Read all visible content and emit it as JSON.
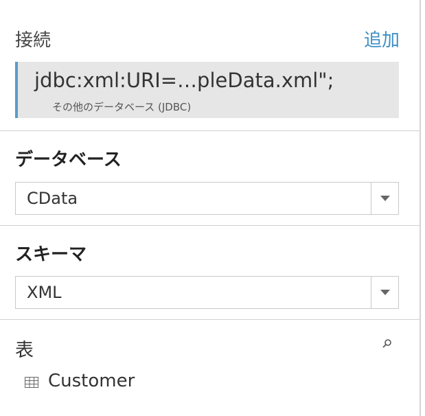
{
  "connection": {
    "title": "接続",
    "add_label": "追加",
    "connection_string": "jdbc:xml:URI=…pleData.xml\";",
    "connection_type": "その他のデータベース (JDBC)"
  },
  "database": {
    "label": "データベース",
    "selected": "CData"
  },
  "schema": {
    "label": "スキーマ",
    "selected": "XML"
  },
  "tables": {
    "label": "表",
    "items": [
      {
        "name": "Customer",
        "icon": "table-grid-icon"
      }
    ]
  },
  "colors": {
    "accent": "#3d8fc6",
    "connection_bar": "#5b9dc9",
    "connection_bg": "#e6e6e6"
  }
}
